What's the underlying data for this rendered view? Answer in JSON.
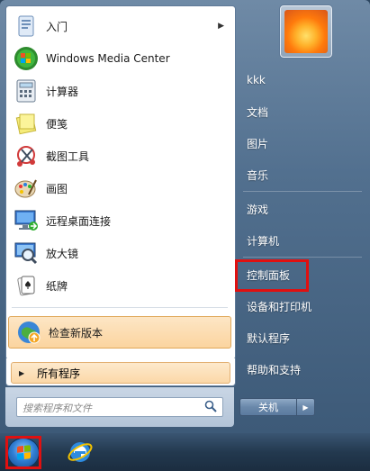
{
  "left_items": [
    {
      "label": "入门",
      "icon": "getting-started-icon",
      "has_arrow": true
    },
    {
      "label": "Windows Media Center",
      "icon": "windows-media-center-icon"
    },
    {
      "label": "计算器",
      "icon": "calculator-icon"
    },
    {
      "label": "便笺",
      "icon": "sticky-notes-icon"
    },
    {
      "label": "截图工具",
      "icon": "snipping-tool-icon"
    },
    {
      "label": "画图",
      "icon": "paint-icon"
    },
    {
      "label": "远程桌面连接",
      "icon": "remote-desktop-icon"
    },
    {
      "label": "放大镜",
      "icon": "magnifier-icon"
    },
    {
      "label": "纸牌",
      "icon": "solitaire-icon"
    },
    {
      "label": "检查新版本",
      "icon": "update-check-icon",
      "highlighted": true
    }
  ],
  "all_programs": {
    "label": "所有程序"
  },
  "search": {
    "placeholder": "搜索程序和文件"
  },
  "right_links": [
    {
      "label": "kkk"
    },
    {
      "label": "文档"
    },
    {
      "label": "图片"
    },
    {
      "label": "音乐"
    },
    {
      "label": "游戏"
    },
    {
      "label": "计算机"
    },
    {
      "label": "控制面板",
      "highlighted_box": true
    },
    {
      "label": "设备和打印机"
    },
    {
      "label": "默认程序"
    },
    {
      "label": "帮助和支持"
    }
  ],
  "shutdown": {
    "label": "关机"
  },
  "taskbar": {
    "pinned": [
      {
        "icon": "start-orb-icon",
        "highlighted_box": true
      },
      {
        "icon": "internet-explorer-icon"
      }
    ]
  },
  "colors": {
    "highlight_box": "#e01010",
    "hover_item": "#fbd49f"
  }
}
